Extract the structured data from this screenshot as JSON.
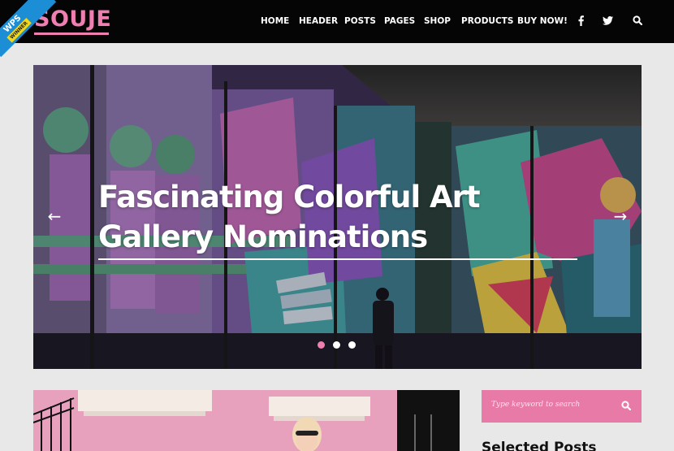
{
  "brand": {
    "logo": "SOUJE",
    "ribbon_text": "WPS",
    "ribbon_badge": "WINNER"
  },
  "nav": {
    "items": [
      "HOME",
      "HEADER",
      "POSTS",
      "PAGES",
      "SHOP",
      "PRODUCTS",
      "BUY NOW!"
    ],
    "social": [
      "facebook-icon",
      "twitter-icon"
    ],
    "search_icon": "search-icon"
  },
  "hero": {
    "title_line1": "Fascinating Colorful Art",
    "title_line2": "Gallery Nominations",
    "prev_icon": "←",
    "next_icon": "→",
    "slide_count": 3,
    "active_slide": 1
  },
  "sidebar": {
    "search_placeholder": "Type keyword to search",
    "widget_title": "Selected Posts"
  },
  "colors": {
    "accent": "#ee7fb0",
    "header_bg": "#050505",
    "page_bg": "#e8e8e8"
  }
}
